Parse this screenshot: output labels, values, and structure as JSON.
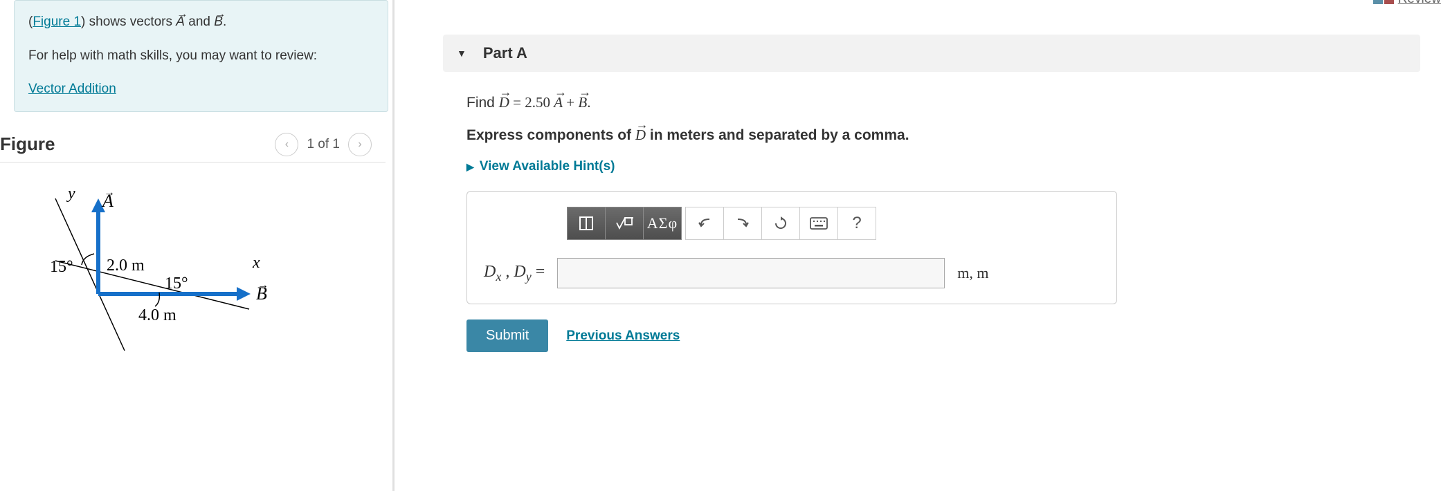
{
  "left": {
    "intro_prefix": "(",
    "figure_link": "Figure 1",
    "intro_after_link": ") shows vectors ",
    "vec_A": "A",
    "intro_and": " and ",
    "vec_B": "B",
    "intro_period": ".",
    "help_line": "For help with math skills, you may want to review:",
    "vector_addition": "Vector Addition",
    "figure_title": "Figure",
    "nav_label": "1 of 1",
    "figure_data": {
      "vec_A_label": "A",
      "vec_B_label": "B",
      "x_label": "x",
      "y_label": "y",
      "angle_A": "15°",
      "angle_B": "15°",
      "len_A": "2.0 m",
      "len_B": "4.0 m"
    }
  },
  "right": {
    "review": "Review",
    "part_title": "Part A",
    "prompt_find": "Find ",
    "vec_D": "D",
    "prompt_eq": " = 2.50 ",
    "vec_A2": "A",
    "prompt_plus": " + ",
    "vec_B2": "B",
    "prompt_period": ".",
    "express_pre": "Express components of ",
    "express_post": " in meters and separated by a comma.",
    "hints": "View Available Hint(s)",
    "toolbar": {
      "greek": "ΑΣφ",
      "help": "?"
    },
    "answer": {
      "label_Dx": "D",
      "sub_x": "x",
      "label_comma": " , ",
      "label_Dy": "D",
      "sub_y": "y",
      "eq": " =",
      "value": "",
      "unit": "m, m"
    },
    "submit": "Submit",
    "previous": "Previous Answers"
  }
}
